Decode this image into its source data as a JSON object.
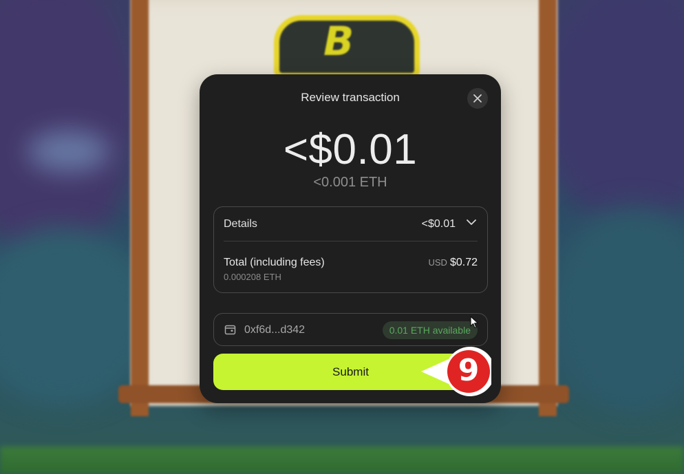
{
  "modal": {
    "title": "Review transaction",
    "amount_fiat": "<$0.01",
    "amount_crypto": "<0.001 ETH",
    "details": {
      "label": "Details",
      "value": "<$0.01",
      "total_label": "Total (including fees)",
      "total_eth": "0.000208 ETH",
      "total_currency": "USD",
      "total_value": "$0.72"
    },
    "wallet": {
      "address": "0xf6d...d342",
      "balance": "0.01 ETH available"
    },
    "submit_label": "Submit"
  },
  "annotation": {
    "step": "9",
    "color": "#e02424"
  },
  "colors": {
    "modal_bg": "#1f1f1f",
    "accent": "#c6f431",
    "available": "#5aa85e"
  },
  "icons": {
    "close": "close-icon",
    "chevron": "chevron-down-icon",
    "wallet": "wallet-icon",
    "cursor": "mouse-cursor-icon"
  }
}
